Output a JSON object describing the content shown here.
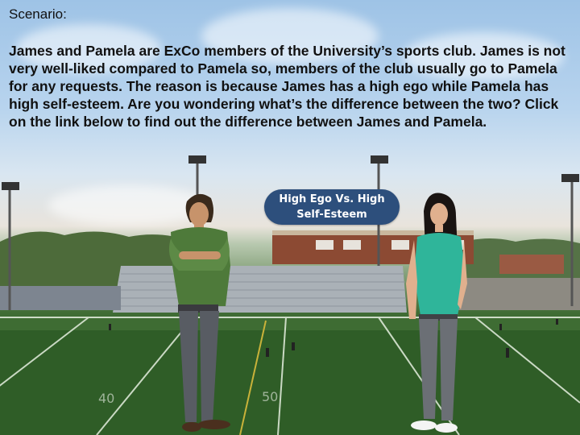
{
  "scenario": {
    "heading": "Scenario:",
    "body": "James and Pamela are ExCo members of the University’s sports club. James is not very well-liked compared to Pamela so, members of the club usually go to Pamela for any requests. The reason is because James has a high ego while Pamela has high self-esteem. Are you wondering what’s the difference between the two? Click on the link below to find out the difference between James and Pamela."
  },
  "link_button": {
    "label": "High Ego Vs. High Self-Esteem"
  },
  "field": {
    "yard_marker_left": "40",
    "yard_marker_center": "50"
  },
  "colors": {
    "button_bg": "#2d4f7c",
    "james_shirt": "#4e7a3a",
    "pamela_shirt": "#2fb59a"
  }
}
